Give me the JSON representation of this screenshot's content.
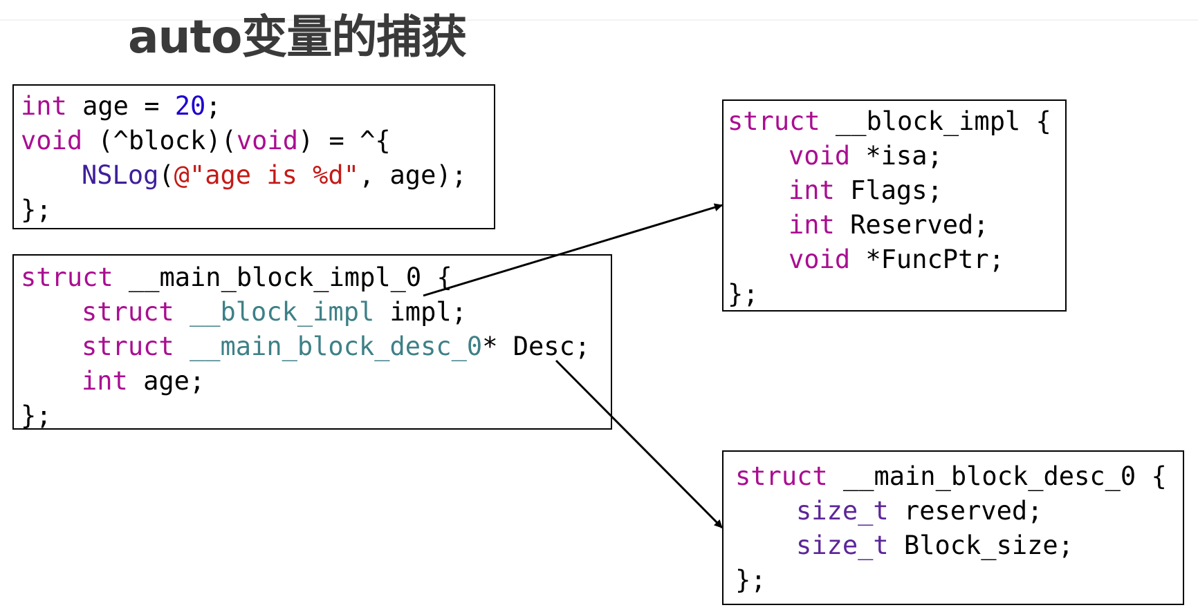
{
  "title": "auto变量的捕获",
  "source_code": {
    "line1": {
      "kw": "int",
      "mid": " age = ",
      "num": "20",
      "end": ";"
    },
    "line2": {
      "kw1": "void",
      "mid1": " (^block)(",
      "kw2": "void",
      "end": ") = ^{"
    },
    "line3": {
      "fn": "NSLog",
      "open": "(",
      "str": "@\"age is %d\"",
      "end": ", age);"
    },
    "line4": "};"
  },
  "main_block_impl": {
    "line1": {
      "kw": "struct",
      "rest": " __main_block_impl_0 {"
    },
    "line2": {
      "kw": "struct",
      "sp": " ",
      "type": "__block_impl",
      "rest": " impl;"
    },
    "line3": {
      "kw": "struct",
      "sp": " ",
      "type": "__main_block_desc_0",
      "rest": "* Desc;"
    },
    "line4": {
      "kw": "int",
      "rest": " age;"
    },
    "line5": "};"
  },
  "block_impl": {
    "line1": {
      "kw": "struct",
      "rest": " __block_impl {"
    },
    "line2": {
      "kw": "void",
      "rest": " *isa;"
    },
    "line3": {
      "kw": "int",
      "rest": " Flags;"
    },
    "line4": {
      "kw": "int",
      "rest": " Reserved;"
    },
    "line5": {
      "kw": "void",
      "rest": " *FuncPtr;"
    },
    "line6": "};"
  },
  "main_block_desc": {
    "line1": {
      "kw": "struct",
      "rest": " __main_block_desc_0 {"
    },
    "line2": {
      "type": "size_t",
      "rest": " reserved;"
    },
    "line3": {
      "type": "size_t",
      "rest": " Block_size;"
    },
    "line4": "};"
  }
}
